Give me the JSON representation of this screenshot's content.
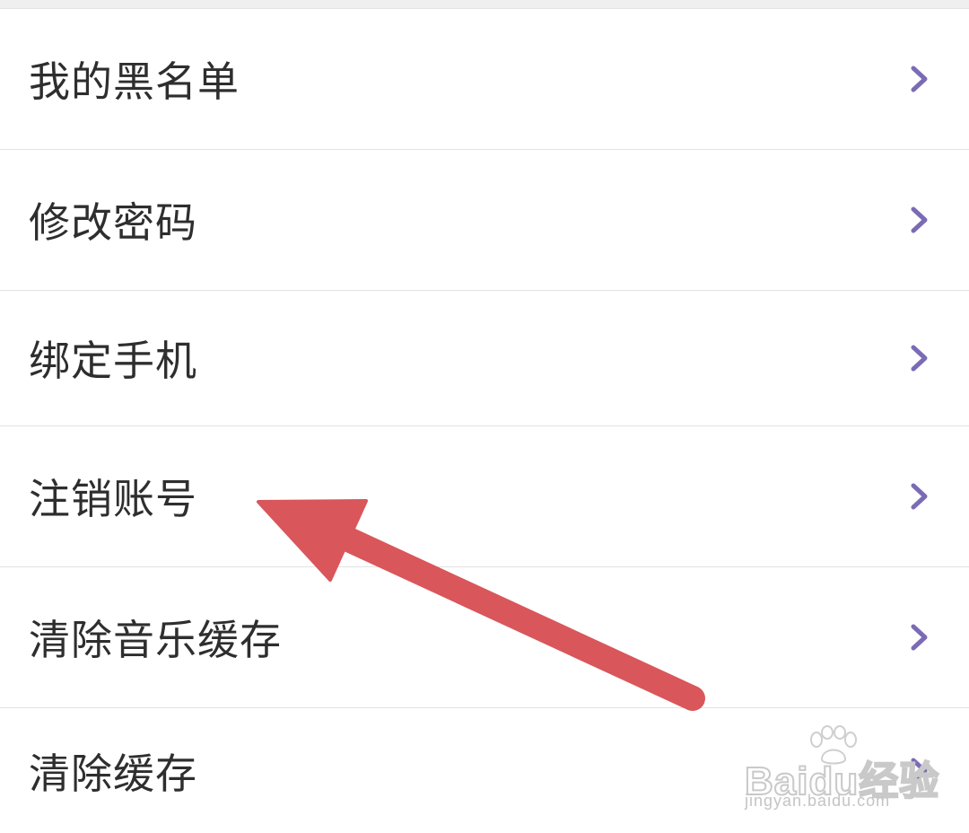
{
  "settings": {
    "items": [
      {
        "label": "我的黑名单"
      },
      {
        "label": "修改密码"
      },
      {
        "label": "绑定手机"
      },
      {
        "label": "注销账号"
      },
      {
        "label": "清除音乐缓存"
      },
      {
        "label": "清除缓存"
      }
    ],
    "chevron_icon": "chevron-right-icon",
    "chevron_color": "#7b6bb5"
  },
  "annotation": {
    "icon": "red-arrow-annotation",
    "color": "#d9565b",
    "points_to": "注销账号"
  },
  "watermark": {
    "brand_text": "Baidu经验",
    "url_text": "jingyan.baidu.com"
  }
}
